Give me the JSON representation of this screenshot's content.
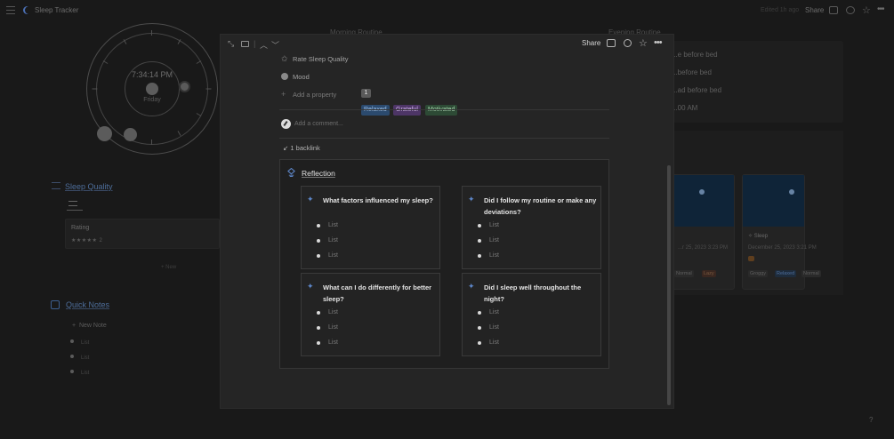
{
  "app": {
    "title": "Sleep Tracker",
    "edited_text": "Edited 1h ago",
    "share_label": "Share"
  },
  "background": {
    "clock": {
      "time": "7:34:14 PM",
      "day": "Friday"
    },
    "sleep_quality": {
      "title": "Sleep Quality",
      "card_label": "Rating",
      "stars": "★★★★★ 2",
      "new_label": "+ New"
    },
    "quick_notes": {
      "title": "Quick Notes",
      "new_label": "New Note",
      "items": [
        "List",
        "List",
        "List"
      ]
    },
    "morning_routine": {
      "title": "Morning Routine"
    },
    "evening_routine": {
      "title": "Evening Routine",
      "items": [
        "...e before bed",
        "...before bed",
        "...ad before bed",
        "...00 AM"
      ]
    },
    "gallery": [
      {
        "date": "...r 25, 2023 3:23 PM",
        "tags": [
          "Normal",
          "Lazy"
        ]
      },
      {
        "title": "Sleep",
        "date": "December 25, 2023 3:21 PM",
        "tags": [
          "Groggy",
          "Relaxed",
          "Normal"
        ]
      }
    ],
    "help": "?"
  },
  "modal": {
    "share_label": "Share",
    "properties": {
      "rate_label": "Rate Sleep Quality",
      "rate_value": "1",
      "mood_label": "Mood",
      "moods": [
        "Relaxed",
        "Grateful",
        "Motivated"
      ],
      "add_property": "Add a property"
    },
    "comment_placeholder": "Add a comment...",
    "backlink": "1 backlink",
    "reflection": {
      "title": "Reflection",
      "questions": [
        {
          "q": "What factors influenced my sleep?",
          "items": [
            "List",
            "List",
            "List"
          ]
        },
        {
          "q": "Did I follow my routine or make any deviations?",
          "items": [
            "List",
            "List",
            "List"
          ]
        },
        {
          "q": "What can I do differently for better sleep?",
          "items": [
            "List",
            "List",
            "List"
          ]
        },
        {
          "q": "Did I sleep well throughout the night?",
          "items": [
            "List",
            "List",
            "List"
          ]
        }
      ]
    }
  },
  "colors": {
    "relaxed": "#2b4a6e",
    "grateful": "#4d3566",
    "motivated": "#2d4a35",
    "link_blue": "#4d6d9a",
    "sparkle": "#5d86c8"
  }
}
